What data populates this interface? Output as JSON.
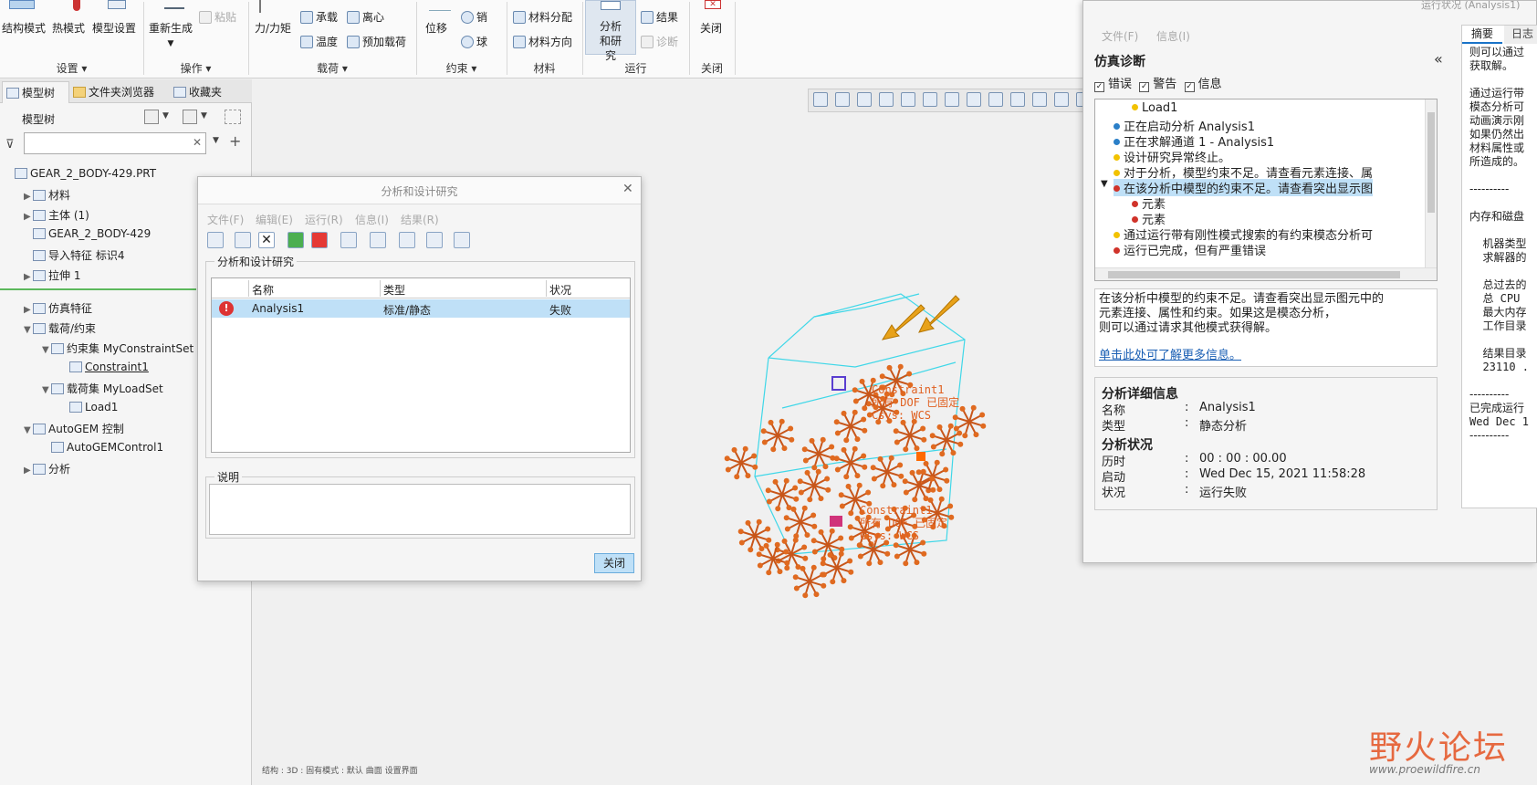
{
  "ribbon": {
    "buttons": {
      "structure_mode": "结构模式",
      "thermal_mode": "热模式",
      "model_setup": "模型设置",
      "regenerate": "重新生成",
      "paste": "粘贴",
      "force_moment": "力/力矩",
      "bearing": "承载",
      "centrifugal": "离心",
      "temperature": "温度",
      "preload": "预加载荷",
      "displacement": "位移",
      "pin": "销",
      "ball": "球",
      "material_assign": "材料分配",
      "material_orient": "材料方向",
      "analysis_study": "分析和研究",
      "results": "结果",
      "diagnose": "诊断",
      "close": "关闭"
    },
    "groups": {
      "settings": "设置 ▾",
      "operations": "操作 ▾",
      "loads": "载荷 ▾",
      "constraints": "约束 ▾",
      "material": "材料",
      "run": "运行",
      "close": "关闭"
    }
  },
  "left_panel": {
    "tabs": [
      "模型树",
      "文件夹浏览器",
      "收藏夹"
    ],
    "header": "模型树",
    "tree": [
      {
        "label": "GEAR_2_BODY-429.PRT",
        "indent": 0,
        "arrow": ""
      },
      {
        "label": "材料",
        "indent": 1,
        "arrow": "▶"
      },
      {
        "label": "主体 (1)",
        "indent": 1,
        "arrow": "▶"
      },
      {
        "label": "GEAR_2_BODY-429",
        "indent": 1,
        "arrow": ""
      },
      {
        "label": "导入特征 标识4",
        "indent": 1,
        "arrow": ""
      },
      {
        "label": "拉伸 1",
        "indent": 1,
        "arrow": "▶"
      },
      {
        "label": "仿真特征",
        "indent": 1,
        "arrow": "▶"
      },
      {
        "label": "载荷/约束",
        "indent": 1,
        "arrow": "▼"
      },
      {
        "label": "约束集 MyConstraintSet",
        "indent": 2,
        "arrow": "▼"
      },
      {
        "label": "Constraint1",
        "indent": 3,
        "arrow": ""
      },
      {
        "label": "载荷集 MyLoadSet",
        "indent": 2,
        "arrow": "▼"
      },
      {
        "label": "Load1",
        "indent": 3,
        "arrow": ""
      },
      {
        "label": "AutoGEM 控制",
        "indent": 1,
        "arrow": "▼"
      },
      {
        "label": "AutoGEMControl1",
        "indent": 2,
        "arrow": ""
      },
      {
        "label": "分析",
        "indent": 1,
        "arrow": "▶"
      }
    ]
  },
  "analysis_dialog": {
    "title": "分析和设计研究",
    "menus": [
      "文件(F)",
      "编辑(E)",
      "运行(R)",
      "信息(I)",
      "结果(R)"
    ],
    "group_label": "分析和设计研究",
    "columns": [
      "名称",
      "类型",
      "状况"
    ],
    "rows": [
      {
        "name": "Analysis1",
        "type": "标准/静态",
        "status": "失败"
      }
    ],
    "desc_label": "说明",
    "close_btn": "关闭"
  },
  "viewport": {
    "label1": "Constraint1",
    "label2": "所有 DOF 已固定",
    "label3": "Csys: WCS",
    "status_bar": "结构 : 3D : 固有模式 : 默认 曲面 设置界面"
  },
  "diag_window": {
    "title": "运行状况 (Analysis1)",
    "menus": [
      "文件(F)",
      "信息(I)"
    ],
    "heading": "仿真诊断",
    "collapse": "«",
    "filters": [
      "错误",
      "警告",
      "信息"
    ],
    "messages": [
      {
        "text": "Load1",
        "color": "#f2c200",
        "indent": 2
      },
      {
        "text": "正在启动分析 Analysis1",
        "color": "#2a7fc8",
        "indent": 1
      },
      {
        "text": "正在求解通道 1 - Analysis1",
        "color": "#2a7fc8",
        "indent": 1
      },
      {
        "text": "设计研究异常终止。",
        "color": "#f2c200",
        "indent": 1
      },
      {
        "text": "对于分析，模型约束不足。请查看元素连接、属",
        "color": "#f2c200",
        "indent": 1
      },
      {
        "text": "在该分析中模型的约束不足。请查看突出显示图",
        "color": "#d0332a",
        "indent": 1,
        "selected": true
      },
      {
        "text": "元素",
        "color": "#d0332a",
        "indent": 2
      },
      {
        "text": "元素",
        "color": "#d0332a",
        "indent": 2
      },
      {
        "text": "通过运行带有刚性模式搜索的有约束模态分析可",
        "color": "#f2c200",
        "indent": 1
      },
      {
        "text": "运行已完成，但有严重错误",
        "color": "#d0332a",
        "indent": 1
      }
    ],
    "description": [
      "在该分析中模型的约束不足。请查看突出显示图元中的",
      "元素连接、属性和约束。如果这是模态分析，",
      "则可以通过请求其他模式获得解。"
    ],
    "more_info_link": "单击此处可了解更多信息。",
    "details_heading": "分析详细信息",
    "details": [
      {
        "k": "名称",
        "v": "Analysis1"
      },
      {
        "k": "类型",
        "v": "静态分析"
      }
    ],
    "status_heading": "分析状况",
    "status": [
      {
        "k": "历时",
        "v": "00 : 00 : 00.00"
      },
      {
        "k": "启动",
        "v": "Wed Dec 15, 2021   11:58:28"
      },
      {
        "k": "状况",
        "v": "运行失败"
      }
    ],
    "right_tabs": [
      "摘要",
      "日志"
    ],
    "log_lines": [
      "则可以通过",
      "获取解。",
      "",
      "通过运行带",
      "模态分析可",
      "动画演示刚",
      "如果仍然出",
      "材料属性或",
      "所造成的。",
      "",
      "----------",
      "",
      "内存和磁盘",
      "",
      "  机器类型",
      "  求解器的",
      "",
      "  总过去的",
      "  总 CPU",
      "  最大内存",
      "  工作目录",
      "",
      "  结果目录",
      "  23110 .",
      "",
      "----------",
      "已完成运行",
      "Wed Dec 1",
      "----------"
    ]
  },
  "watermark": {
    "text": "野火论坛",
    "url": "www.proewildfire.cn"
  }
}
